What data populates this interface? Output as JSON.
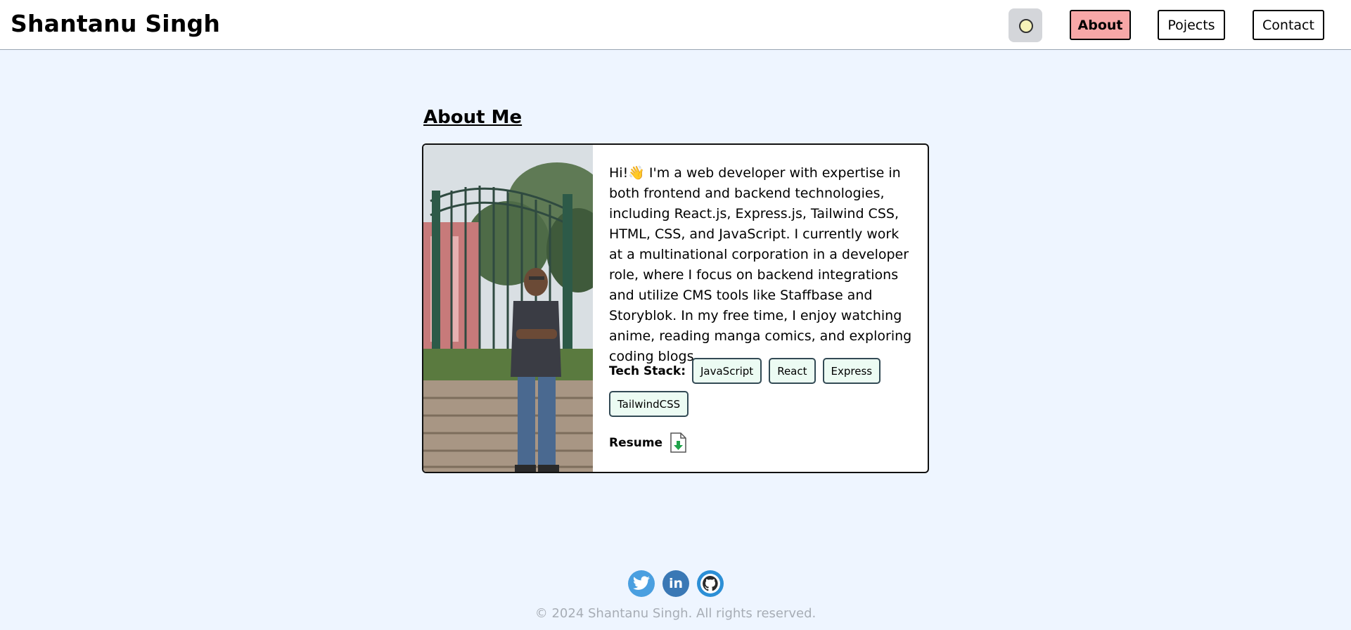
{
  "header": {
    "brand": "Shantanu Singh",
    "nav": {
      "about": "About",
      "projects": "Pojects",
      "contact": "Contact"
    },
    "theme_icon": "sun-icon"
  },
  "about": {
    "title": "About Me",
    "bio": "Hi!👋 I'm a web developer with expertise in both frontend and backend technologies, including React.js, Express.js, Tailwind CSS, HTML, CSS, and JavaScript. I currently work at a multinational corporation in a developer role, where I focus on backend integrations and utilize CMS tools like Staffbase and Storyblok. In my free time, I enjoy watching anime, reading manga comics, and exploring coding blogs.",
    "tech_label": "Tech Stack:",
    "tech_stack": [
      "JavaScript",
      "React",
      "Express",
      "TailwindCSS"
    ],
    "resume_label": "Resume",
    "resume_icon": "download-file-icon"
  },
  "footer": {
    "social_icons": [
      "twitter-icon",
      "linkedin-icon",
      "github-icon"
    ],
    "copyright": "© 2024 Shantanu Singh. All rights reserved."
  },
  "colors": {
    "page_bg": "#eef5ff",
    "about_active": "#f7a7a7",
    "chip_bg": "#ecfbf3"
  }
}
